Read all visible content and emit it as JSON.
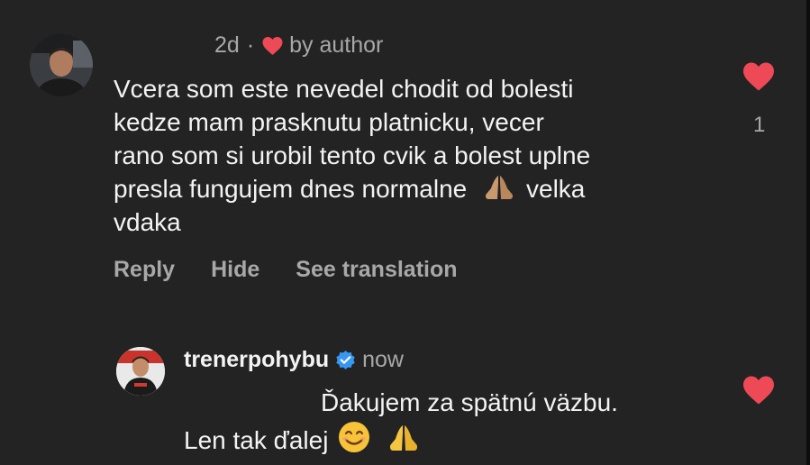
{
  "comment": {
    "time": "2d",
    "separator": "·",
    "liked_by": "by author",
    "lines": [
      "Vcera som este nevedel chodit od bolesti",
      "kedze mam prasknutu platnicku, vecer",
      "rano som si urobil tento cvik a bolest uplne",
      "presla fungujem dnes normalne",
      "velka",
      "vdaka"
    ],
    "like_count": "1",
    "actions": {
      "reply": "Reply",
      "hide": "Hide",
      "translate": "See translation"
    }
  },
  "reply": {
    "username": "trenerpohybu",
    "time": "now",
    "line1": "Ďakujem za spätnú väzbu.",
    "line2": "Len tak ďalej"
  },
  "icons": {
    "heart": "heart-icon",
    "verified": "verified-badge-icon",
    "pray": "folded-hands-emoji",
    "smile": "smiling-face-emoji"
  },
  "colors": {
    "background": "#232323",
    "heart_red": "#ed4956",
    "verified_blue": "#3897f0",
    "muted_text": "#a8a8a8"
  }
}
